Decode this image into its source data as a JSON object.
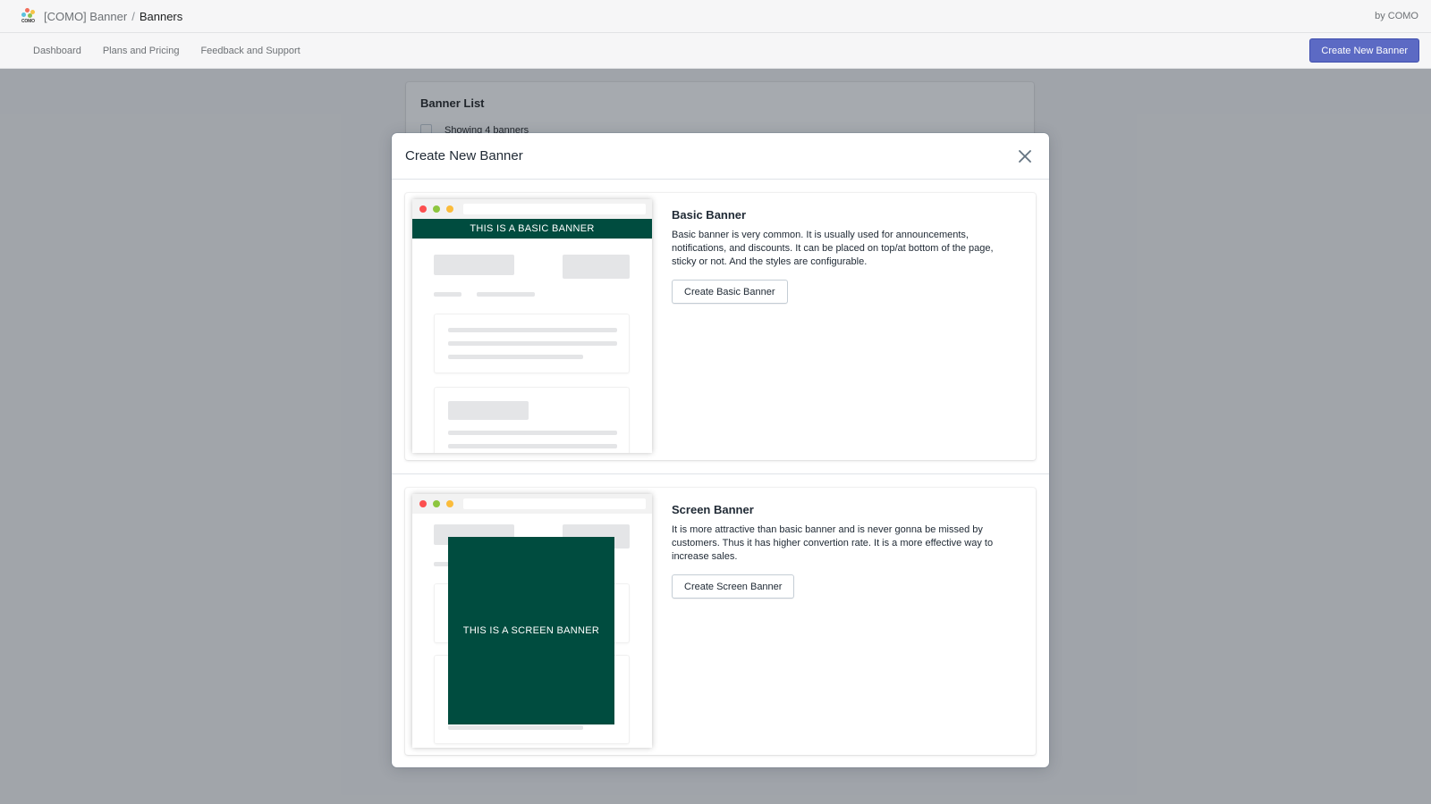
{
  "topbar": {
    "app_name": "[COMO] Banner",
    "separator": "/",
    "page": "Banners",
    "by": "by COMO",
    "logo_text": "COMO"
  },
  "nav": {
    "items": [
      {
        "label": "Dashboard"
      },
      {
        "label": "Plans and Pricing"
      },
      {
        "label": "Feedback and Support"
      }
    ],
    "primary_action": "Create New Banner"
  },
  "background_card": {
    "title": "Banner List",
    "showing": "Showing 4 banners"
  },
  "modal": {
    "title": "Create New Banner",
    "close_icon": "close-icon",
    "options": [
      {
        "title": "Basic Banner",
        "description": "Basic banner is very common. It is usually used for announcements, notifications, and discounts. It can be placed on top/at bottom of the page, sticky or not. And the styles are configurable.",
        "button": "Create Basic Banner",
        "preview_text": "THIS IS A BASIC BANNER"
      },
      {
        "title": "Screen Banner",
        "description": "It is more attractive than basic banner and is never gonna be missed by customers. Thus it has higher convertion rate. It is a more effective way to increase sales.",
        "button": "Create Screen Banner",
        "preview_text": "THIS IS A SCREEN BANNER"
      }
    ]
  },
  "colors": {
    "accent": "#5c6ac4",
    "banner_green": "#004c3f",
    "dot_red": "#fc4f4f",
    "dot_green": "#8dc63f",
    "dot_yellow": "#fbbc3b"
  }
}
